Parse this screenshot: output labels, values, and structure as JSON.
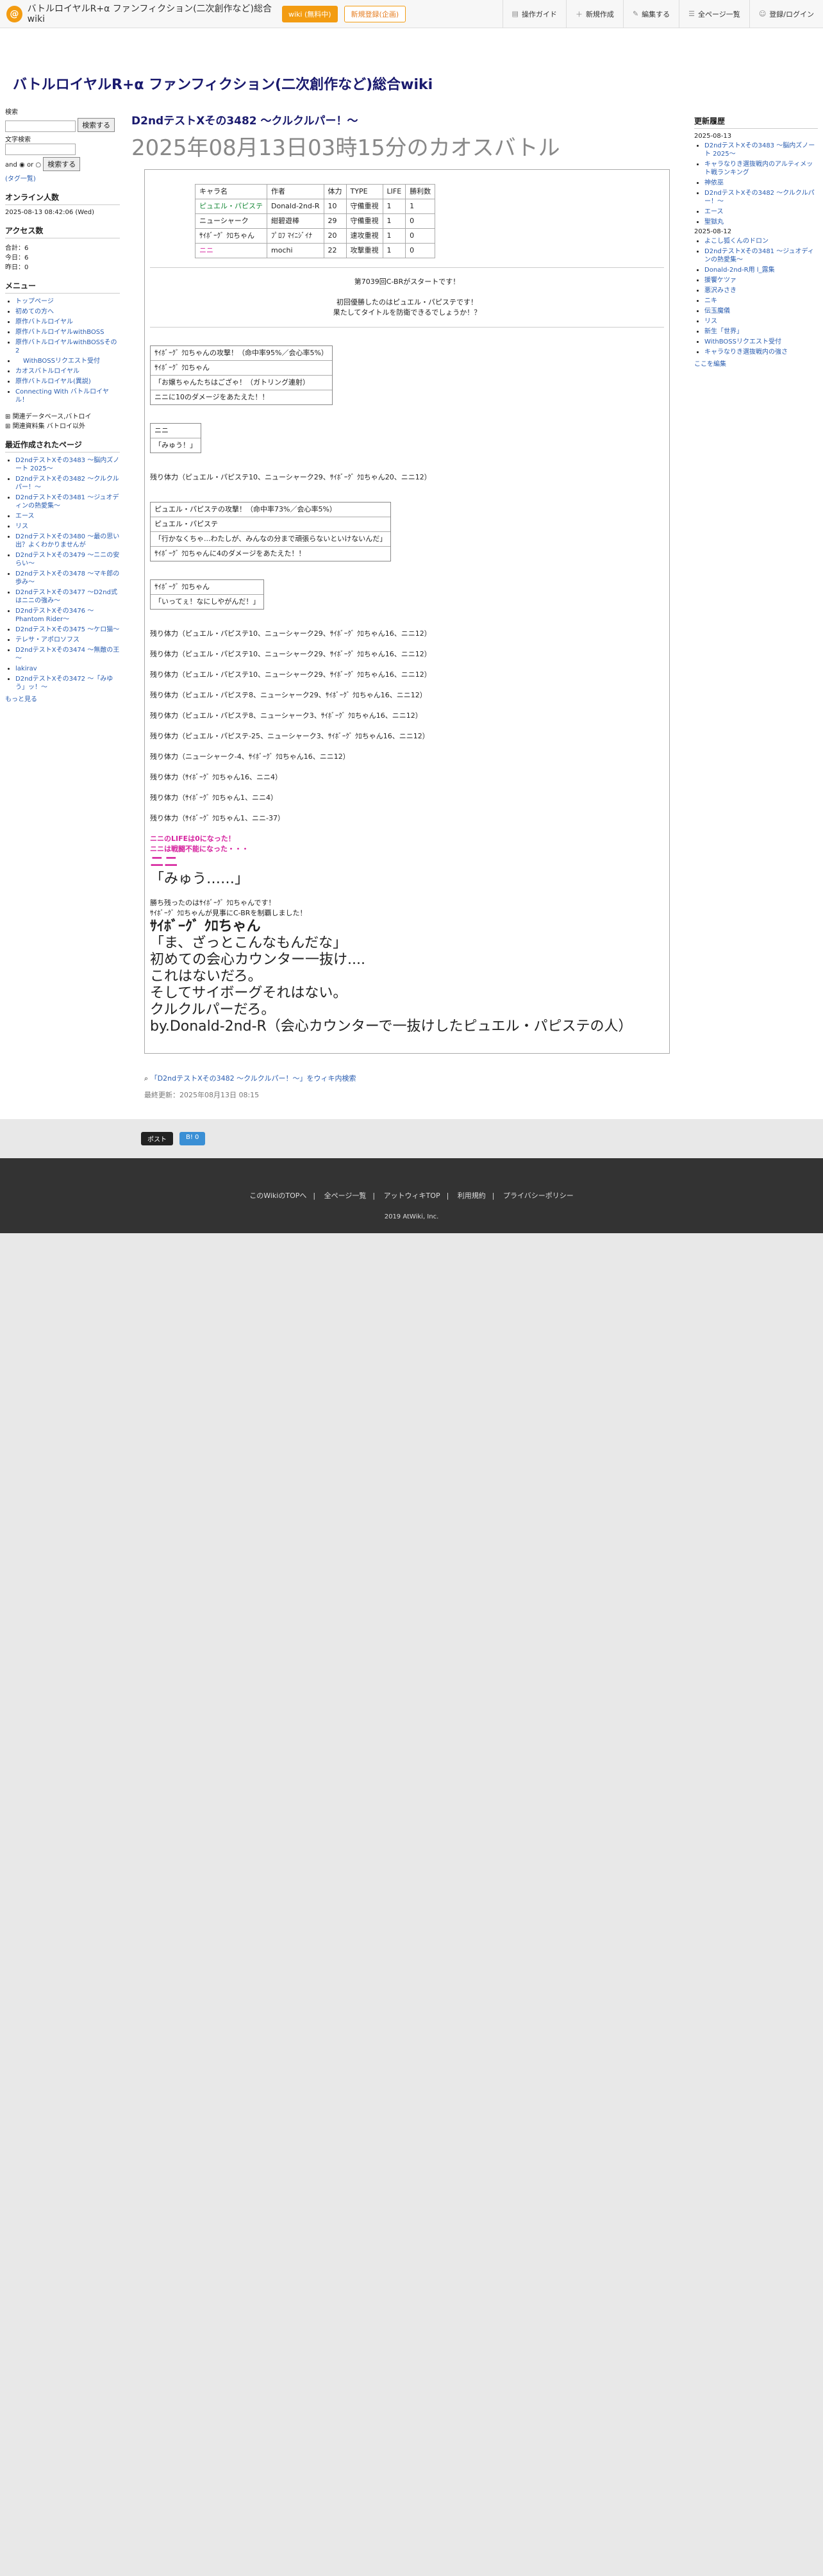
{
  "top": {
    "brand": "バトルロイヤルR+α ファンフィクション(二次創作など)総合wiki",
    "wiki_badge": "wiki (無料中)",
    "register": "新規登録(企画)",
    "nav": [
      "操作ガイド",
      "新規作成",
      "編集する",
      "全ページ一覧",
      "登録/ログイン"
    ]
  },
  "site_title": "バトルロイヤルR+α ファンフィクション(二次創作など)総合wiki",
  "left": {
    "search_label": "検索",
    "search_btn": "検索する",
    "fulltext": "文字検索",
    "and": "and",
    "or": "or",
    "search_btn2": "検索する",
    "tag": "(タグ一覧)",
    "online_title": "オンライン人数",
    "date": "2025-08-13 08:42:06 (Wed)",
    "access_title": "アクセス数",
    "access": [
      "合計：6",
      "今日：6",
      "昨日：0"
    ],
    "menu_title": "メニュー",
    "menu": [
      "トップページ",
      "初めての方へ",
      "原作バトルロイヤル",
      "原作バトルロイヤルwithBOSS",
      "原作バトルロイヤルwithBOSSその2",
      "WithBOSSリクエスト受付",
      "カオスバトルロイヤル",
      "原作バトルロイヤル(異説)",
      "Connecting With バトルロイヤル！"
    ],
    "tree": [
      "関連データベース,バトロイ",
      "関連資料集 バトロイ以外"
    ],
    "recent_title": "最近作成されたページ",
    "recent": [
      "D2ndテストXその3483 ～脳内ズノート 2025～",
      "D2ndテストXその3482 ～クルクルパー！～",
      "D2ndテストXその3481 ～ジュオディンの熱愛集～",
      "エース",
      "リス",
      "D2ndテストXその3480 ～最の思い出？よくわかりませんが",
      "D2ndテストXその3479 ～ニニの安らい～",
      "D2ndテストXその3478 ～マキ郎の歩み～",
      "D2ndテストXその3477 ～D2nd式はニニの強み～",
      "D2ndテストXその3476 ～Phantom Rider～",
      "D2ndテストXその3475 ～ケロ猫～",
      "テレサ・アポロソフス",
      "D2ndテストXその3474 ～無敵の王～",
      "lakirav",
      "D2ndテストXその3472 ～「みゆう」ッ！～"
    ],
    "more": "もっと見る"
  },
  "page": {
    "title": "D2ndテストXその3482 ～クルクルパー！～",
    "subtitle": "2025年08月13日03時15分のカオスバトル"
  },
  "stats": {
    "headers": [
      "キャラ名",
      "作者",
      "体力",
      "TYPE",
      "LIFE",
      "勝利数"
    ],
    "rows": [
      [
        "ピュエル・パピステ",
        "Donald-2nd-R",
        "10",
        "守備重視",
        "1",
        "1"
      ],
      [
        "ニューシャーク",
        "紺碧遊棒",
        "29",
        "守備重視",
        "1",
        "0"
      ],
      [
        "ｻｲﾎﾞｰｸﾞ ｸﾛちゃん",
        "ﾌﾟﾛﾌ ﾏｲﾆｼﾞｲﾅ",
        "20",
        "速攻重視",
        "1",
        "0"
      ],
      [
        "ニニ",
        "mochi",
        "22",
        "攻撃重視",
        "1",
        "0"
      ]
    ]
  },
  "intro": [
    "第7039回C-BRがスタートです！",
    "初回優勝したのはピュエル・パピステです！",
    "果たしてタイトルを防衛できるでしょうか！？"
  ],
  "battle": [
    "ｻｲﾎﾞｰｸﾞ ｸﾛちゃんの攻撃！（命中率95%／会心率5%）|ｻｲﾎﾞｰｸﾞ ｸﾛちゃん|「お嬢ちゃんたちはござゃ！（ガトリング連射）|ニニに10のダメージをあたえた！！",
    "ニニ|「みゅう！」",
    "残り体力（ピュエル・パピステ10、ニューシャーク29、ｻｲﾎﾞｰｸﾞ ｸﾛちゃん20、ニニ12）",
    "ピュエル・パピステの攻撃！（命中率73%／会心率5%）|ピュエル・パピステ|「行かなくちゃ...わたしが、みんなの分まで頑張らないといけないんだ」|ｻｲﾎﾞｰｸﾞ ｸﾛちゃんに4のダメージをあたえた！！",
    "ｻｲﾎﾞｰｸﾞ ｸﾛちゃん|「いってぇ！なにしやがんだ！」",
    "残り体力（ピュエル・パピステ10、ニューシャーク29、ｻｲﾎﾞｰｸﾞ ｸﾛちゃん16、ニニ12）",
    "残り体力（ピュエル・パピステ10、ニューシャーク29、ｻｲﾎﾞｰｸﾞ ｸﾛちゃん16、ニニ12）",
    "残り体力（ピュエル・パピステ10、ニューシャーク29、ｻｲﾎﾞｰｸﾞ ｸﾛちゃん16、ニニ12）",
    "残り体力（ピュエル・パピステ8、ニューシャーク29、ｻｲﾎﾞｰｸﾞ ｸﾛちゃん16、ニニ12）",
    "残り体力（ピュエル・パピステ8、ニューシャーク3、ｻｲﾎﾞｰｸﾞ ｸﾛちゃん16、ニニ12）",
    "残り体力（ピュエル・パピステ-25、ニューシャーク3、ｻｲﾎﾞｰｸﾞ ｸﾛちゃん16、ニニ12）",
    "残り体力（ニューシャーク-4、ｻｲﾎﾞｰｸﾞ ｸﾛちゃん16、ニニ12）",
    "残り体力（ｻｲﾎﾞｰｸﾞ ｸﾛちゃん16、ニニ4）",
    "残り体力（ｻｲﾎﾞｰｸﾞ ｸﾛちゃん1、ニニ4）",
    "残り体力（ｻｲﾎﾞｰｸﾞ ｸﾛちゃん1、ニニ-37）"
  ],
  "ending": {
    "l1": "ニニのLIFEは0になった！",
    "l2": "ニニは戦闘不能になった・・・",
    "name": "ニニ",
    "q": "「みゅう……」",
    "w1": "勝ち残ったのはｻｲﾎﾞｰｸﾞ ｸﾛちゃんです！",
    "w2": "ｻｲﾎﾞｰｸﾞ ｸﾛちゃんが見事にC-BRを制覇しました！",
    "wname": "ｻｲﾎﾞｰｸﾞ ｸﾛちゃん",
    "wq": "「ま、ざっとこんなもんだな」",
    "c1": "初めての会心カウンター一抜け....",
    "c2": "これはないだろ。",
    "c3": "そしてサイボーグそれはない。",
    "c4": "クルクルパーだろ。",
    "c5": "by.Donald-2nd-R（会心カウンターで一抜けしたピュエル・パピステの人）"
  },
  "after": {
    "tag": "「D2ndテストXその3482 ～クルクルパー！～」をウィキ内検索",
    "updated": "最終更新：2025年08月13日 08:15"
  },
  "share": [
    "ポスト",
    "B! 0"
  ],
  "right": {
    "title": "更新履歴",
    "d1": "2025-08-13",
    "l1": [
      "D2ndテストXその3483 ～脳内ズノート 2025～",
      "キャラなりき選抜戦内のアルティメット戦ランキング",
      "神依巫",
      "D2ndテストXその3482 ～クルクルパー！～",
      "エース",
      "聖獄丸"
    ],
    "d2": "2025-08-12",
    "l2": [
      "よこし狐くんのドロン",
      "D2ndテストXその3481 ～ジュオディンの熱愛集～",
      "Donald-2nd-R用 l_露集",
      "援饗ケツァ",
      "悪沢みさき",
      "ニキ",
      "伝玉魔儀",
      "リス",
      "新生「世界」",
      "WithBOSSリクエスト受付",
      "キャラなりき選抜戦内の強さ"
    ],
    "more": "ここを編集"
  },
  "footer": {
    "links": [
      "このWikiのTOPへ",
      "全ページ一覧",
      "アットウィキTOP",
      "利用規約",
      "プライバシーポリシー"
    ],
    "copy": "2019 AtWiki, Inc."
  }
}
